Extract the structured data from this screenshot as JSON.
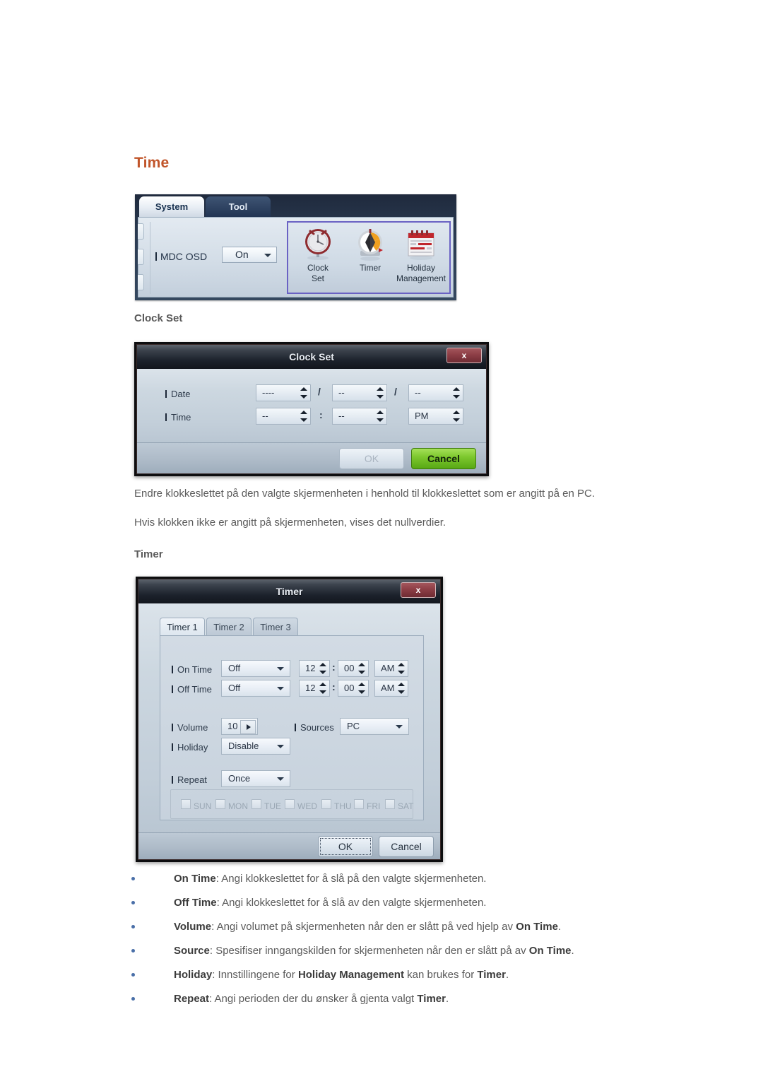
{
  "page": {
    "heading": "Time"
  },
  "mdc_panel": {
    "tabs": [
      {
        "label": "System",
        "selected": true
      },
      {
        "label": "Tool",
        "selected": false
      }
    ],
    "osd": {
      "label": "MDC OSD",
      "value": "On"
    },
    "icons": [
      {
        "name": "clock-set-icon",
        "line1": "Clock",
        "line2": "Set"
      },
      {
        "name": "timer-icon",
        "line1": "Timer",
        "line2": ""
      },
      {
        "name": "holiday-management-icon",
        "line1": "Holiday",
        "line2": "Management"
      }
    ]
  },
  "clock_set": {
    "section_heading": "Clock Set",
    "title": "Clock Set",
    "close_label": "x",
    "rows": [
      {
        "label": "Date",
        "fields": [
          "----",
          "--",
          "--"
        ],
        "separators": [
          "/",
          "/"
        ]
      },
      {
        "label": "Time",
        "fields": [
          "--",
          "--",
          "PM"
        ],
        "separators": [
          ":",
          ""
        ]
      }
    ],
    "ok_label": "OK",
    "cancel_label": "Cancel"
  },
  "paragraphs": [
    "Endre klokkeslettet på den valgte skjermenheten i henhold til klokkeslettet som er angitt på en PC.",
    "Hvis klokken ikke er angitt på skjermenheten, vises det nullverdier."
  ],
  "timer": {
    "section_heading": "Timer",
    "title": "Timer",
    "close_label": "x",
    "tabs": [
      {
        "label": "Timer 1",
        "selected": true
      },
      {
        "label": "Timer 2",
        "selected": false
      },
      {
        "label": "Timer 3",
        "selected": false
      }
    ],
    "on_time": {
      "label": "On Time",
      "mode": "Off",
      "hour": "12",
      "minute": "00",
      "meridiem": "AM"
    },
    "off_time": {
      "label": "Off Time",
      "mode": "Off",
      "hour": "12",
      "minute": "00",
      "meridiem": "AM"
    },
    "volume": {
      "label": "Volume",
      "value": "10"
    },
    "sources": {
      "label": "Sources",
      "value": "PC"
    },
    "holiday": {
      "label": "Holiday",
      "value": "Disable"
    },
    "repeat": {
      "label": "Repeat",
      "value": "Once"
    },
    "days": [
      "SUN",
      "MON",
      "TUE",
      "WED",
      "THU",
      "FRI",
      "SAT"
    ],
    "time_separator": ":",
    "ok_label": "OK",
    "cancel_label": "Cancel"
  },
  "bullets": [
    {
      "term": "On Time",
      "rest": ": Angi klokkeslettet for å slå på den valgte skjermenheten."
    },
    {
      "term": "Off Time",
      "rest": ": Angi klokkeslettet for å slå av den valgte skjermenheten."
    },
    {
      "term": "Volume",
      "rest": ": Angi volumet på skjermenheten når den er slått på ved hjelp av ",
      "term2": "On Time",
      "tail": "."
    },
    {
      "term": "Source",
      "rest": ": Spesifiser inngangskilden for skjermenheten når den er slått på av ",
      "term2": "On Time",
      "tail": "."
    },
    {
      "term": "Holiday",
      "rest": ": Innstillingene for ",
      "term2": "Holiday Management",
      "mid": " kan brukes for ",
      "term3": "Timer",
      "tail": "."
    },
    {
      "term": "Repeat",
      "rest": ": Angi perioden der du ønsker å gjenta valgt ",
      "term2": "Timer",
      "tail": "."
    }
  ],
  "colors": {
    "heading_accent": "#c1552a",
    "body_text": "#5a5a5a",
    "bullet_dot": "#4a6fa8",
    "icon_panel_border": "#6a62c4",
    "cancel_green": "#7ec92f",
    "close_red": "#8d3e46"
  }
}
